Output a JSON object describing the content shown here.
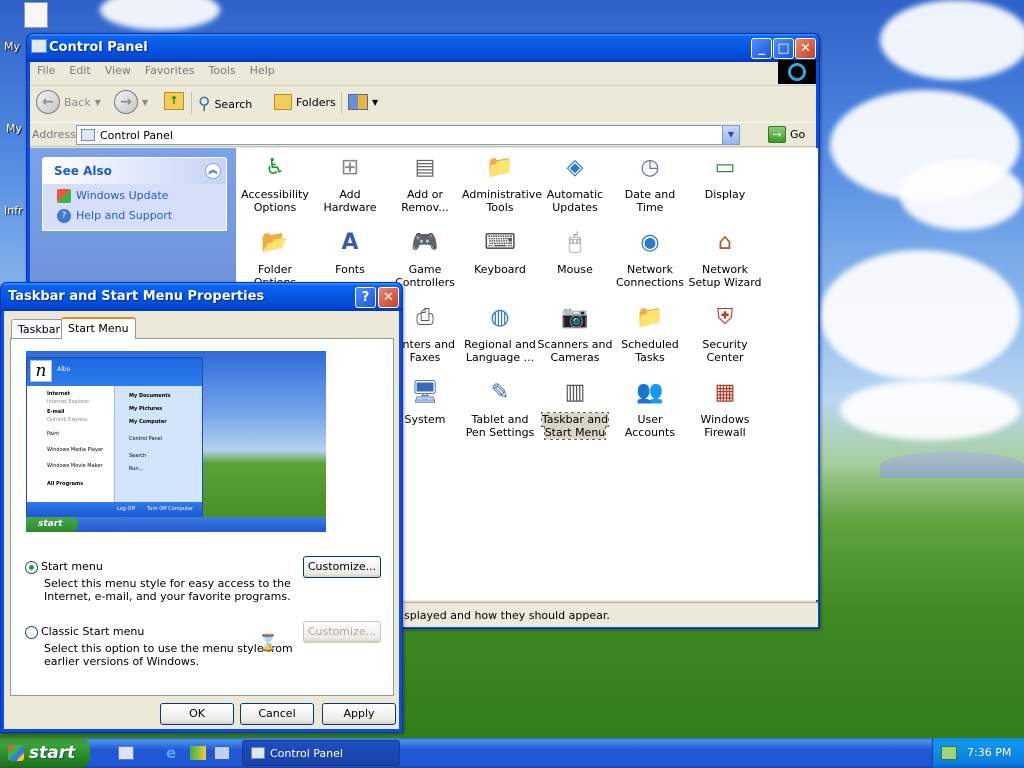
{
  "desktop": {
    "icons": [
      "My",
      "My",
      "Infr"
    ]
  },
  "cp": {
    "title": "Control Panel",
    "menu": [
      "File",
      "Edit",
      "View",
      "Favorites",
      "Tools",
      "Help"
    ],
    "toolbar": {
      "back": "Back",
      "search": "Search",
      "folders": "Folders"
    },
    "address": {
      "label": "Address",
      "value": "Control Panel",
      "go": "Go"
    },
    "see_also": {
      "title": "See Also",
      "links": [
        "Windows Update",
        "Help and Support"
      ]
    },
    "items": [
      "Accessibility Options",
      "Add Hardware",
      "Add or Remov...",
      "Administrative Tools",
      "Automatic Updates",
      "Date and Time",
      "Display",
      "Folder Options",
      "Fonts",
      "Game Controllers",
      "Keyboard",
      "Mouse",
      "Network Connections",
      "Network Setup Wizard",
      "rinters and Faxes",
      "Regional and Language ...",
      "Scanners and Cameras",
      "Scheduled Tasks",
      "Security Center",
      "System",
      "Tablet and Pen Settings",
      "Taskbar and Start Menu",
      "User Accounts",
      "Windows Firewall"
    ],
    "status": "splayed and how they should appear."
  },
  "dlg": {
    "title": "Taskbar and Start Menu Properties",
    "tabs": [
      "Taskbar",
      "Start Menu"
    ],
    "preview": {
      "user": "Albo",
      "left": [
        "Internet",
        "Internet Explorer",
        "E-mail",
        "Outlook Express",
        "Paint",
        "Windows Media Player",
        "Windows Movie Maker",
        "All Programs"
      ],
      "right": [
        "My Documents",
        "My Pictures",
        "My Computer",
        "Control Panel",
        "Search",
        "Run..."
      ],
      "logoff": "Log Off",
      "turnoff": "Turn Off Computer",
      "start": "start"
    },
    "opt1": {
      "label": "Start menu",
      "desc1": "Select this menu style for easy access to the",
      "desc2": "Internet, e-mail, and your favorite programs."
    },
    "opt2": {
      "label": "Classic Start menu",
      "desc1": "Select this option to use the menu style from",
      "desc2": "earlier versions of Windows."
    },
    "customize": "Customize...",
    "ok": "OK",
    "cancel": "Cancel",
    "apply": "Apply"
  },
  "taskbar": {
    "start": "start",
    "task": "Control Panel",
    "time": "7:36 PM"
  }
}
